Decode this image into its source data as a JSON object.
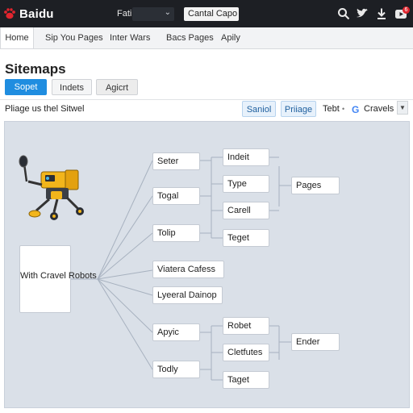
{
  "app": {
    "logo_text": "Baidu",
    "search_label": "Fati",
    "site_select": "Cantal Capo",
    "icons": [
      "search-icon",
      "twitter-icon",
      "download-icon",
      "youtube-icon"
    ],
    "notification_count": "6"
  },
  "nav": {
    "tabs": [
      "Home",
      "Sip You Pages",
      "Inter Wars",
      "Bacs Pages",
      "Apily"
    ],
    "active_tab": "Home"
  },
  "page": {
    "title": "Sitemaps",
    "buttons": [
      "Sopet",
      "Indets",
      "Agicrt"
    ],
    "subtitle": "Pliage us thel Sitwel",
    "filters": [
      "Saniol",
      "Priiage"
    ],
    "label_tebt": "Tebt",
    "g_logo": "G",
    "cravels": "Cravels"
  },
  "diagram": {
    "root": "With Cravel Robots",
    "level1": [
      "Seter",
      "Togal",
      "Tolip",
      "Viatera Cafess",
      "Lyeeral Dainop",
      "Apyic",
      "Todly"
    ],
    "level2": [
      "Indeit",
      "Type",
      "Carell",
      "Teget",
      "Robet",
      "Cletfutes",
      "Taget"
    ],
    "level3": [
      "Pages",
      "Ender"
    ]
  },
  "colors": {
    "topbar": "#1d1f24",
    "accent": "#1f8de0",
    "canvas": "#dae0e8",
    "robot_body": "#f2b51b"
  }
}
